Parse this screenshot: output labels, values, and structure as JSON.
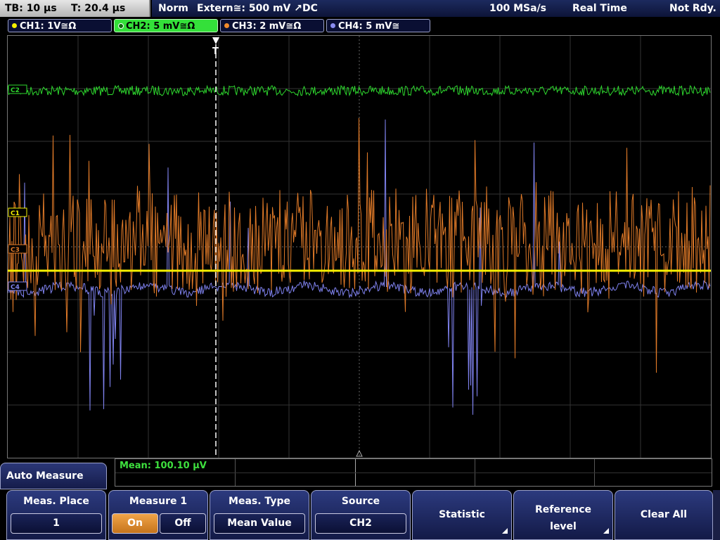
{
  "status_bar": {
    "timebase": "TB: 10 µs",
    "trigger_time": "T: 20.4 µs",
    "trigger_mode": "Norm",
    "trigger_source": "Extern≅: 500 mV ↗DC",
    "sample_rate": "100 MSa/s",
    "acq_mode": "Real Time",
    "state": "Not Rdy."
  },
  "channels": [
    {
      "label": "CH1: 1V≅Ω",
      "color": "#f5f000",
      "active": false
    },
    {
      "label": "CH2: 5 mV≅Ω",
      "color": "#2ed82e",
      "active": true
    },
    {
      "label": "CH3: 2 mV≅Ω",
      "color": "#f08a2a",
      "active": false
    },
    {
      "label": "CH4: 5 mV≅",
      "color": "#8a8cf0",
      "active": false
    }
  ],
  "markers": {
    "c1": "C1",
    "c2": "C2",
    "c3": "C3",
    "c4": "C4",
    "trigger": "T"
  },
  "measurement": {
    "mean": "Mean: 100.10 µV"
  },
  "menu": {
    "title": "Auto Measure",
    "meas_place": {
      "title": "Meas. Place",
      "value": "1"
    },
    "measure1": {
      "title": "Measure 1",
      "on": "On",
      "off": "Off",
      "state": "On"
    },
    "meas_type": {
      "title": "Meas. Type",
      "value": "Mean Value"
    },
    "source": {
      "title": "Source",
      "value": "CH2"
    },
    "statistic": "Statistic",
    "reference_level_1": "Reference",
    "reference_level_2": "level",
    "clear_all": "Clear All"
  },
  "colors": {
    "ch1": "#f5f000",
    "ch2": "#2ed82e",
    "ch3": "#e07a28",
    "ch4": "#7f82ee",
    "grid": "#555555",
    "accent_on": "#e08a30"
  }
}
